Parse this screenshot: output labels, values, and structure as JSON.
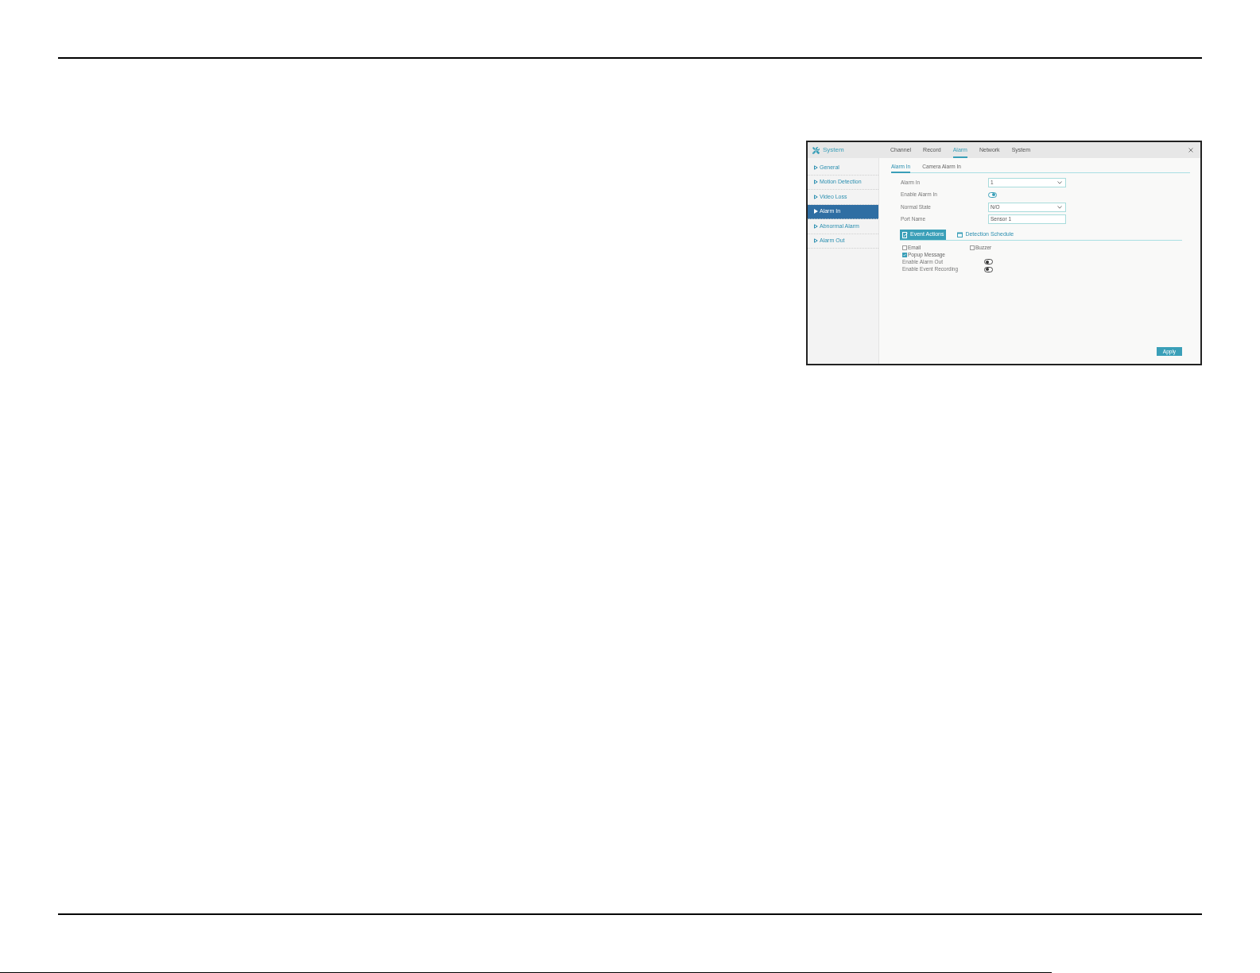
{
  "window": {
    "title": "System"
  },
  "tabs": [
    {
      "label": "Channel",
      "selected": false
    },
    {
      "label": "Record",
      "selected": false
    },
    {
      "label": "Alarm",
      "selected": true
    },
    {
      "label": "Network",
      "selected": false
    },
    {
      "label": "System",
      "selected": false
    }
  ],
  "sidebar": {
    "items": [
      {
        "label": "General",
        "selected": false
      },
      {
        "label": "Motion Detection",
        "selected": false
      },
      {
        "label": "Video Loss",
        "selected": false
      },
      {
        "label": "Alarm In",
        "selected": true
      },
      {
        "label": "Abnormal Alarm",
        "selected": false
      },
      {
        "label": "Alarm Out",
        "selected": false
      }
    ]
  },
  "subtabs": [
    {
      "label": "Alarm In",
      "selected": true
    },
    {
      "label": "Camera Alarm In",
      "selected": false
    }
  ],
  "form": {
    "fields": [
      {
        "kind": "select",
        "label": "Alarm In",
        "value": "1"
      },
      {
        "kind": "toggle",
        "label": "Enable Alarm In",
        "on": true
      },
      {
        "kind": "select",
        "label": "Normal State",
        "value": "N/O"
      },
      {
        "kind": "text",
        "label": "Port Name",
        "value": "Sensor 1"
      }
    ]
  },
  "section_tabs": [
    {
      "kind": "actions",
      "label": "Event Actions",
      "selected": true
    },
    {
      "kind": "schedule",
      "label": "Detection Schedule",
      "selected": false
    }
  ],
  "actions": {
    "checkboxes": [
      {
        "label": "Email",
        "checked": false
      },
      {
        "label": "Buzzer",
        "checked": false
      },
      {
        "label": "Popup Message",
        "checked": true
      }
    ],
    "toggles": [
      {
        "label": "Enable Alarm Out",
        "on": false
      },
      {
        "label": "Enable Event Recording",
        "on": false
      }
    ]
  },
  "apply_button": "Apply"
}
